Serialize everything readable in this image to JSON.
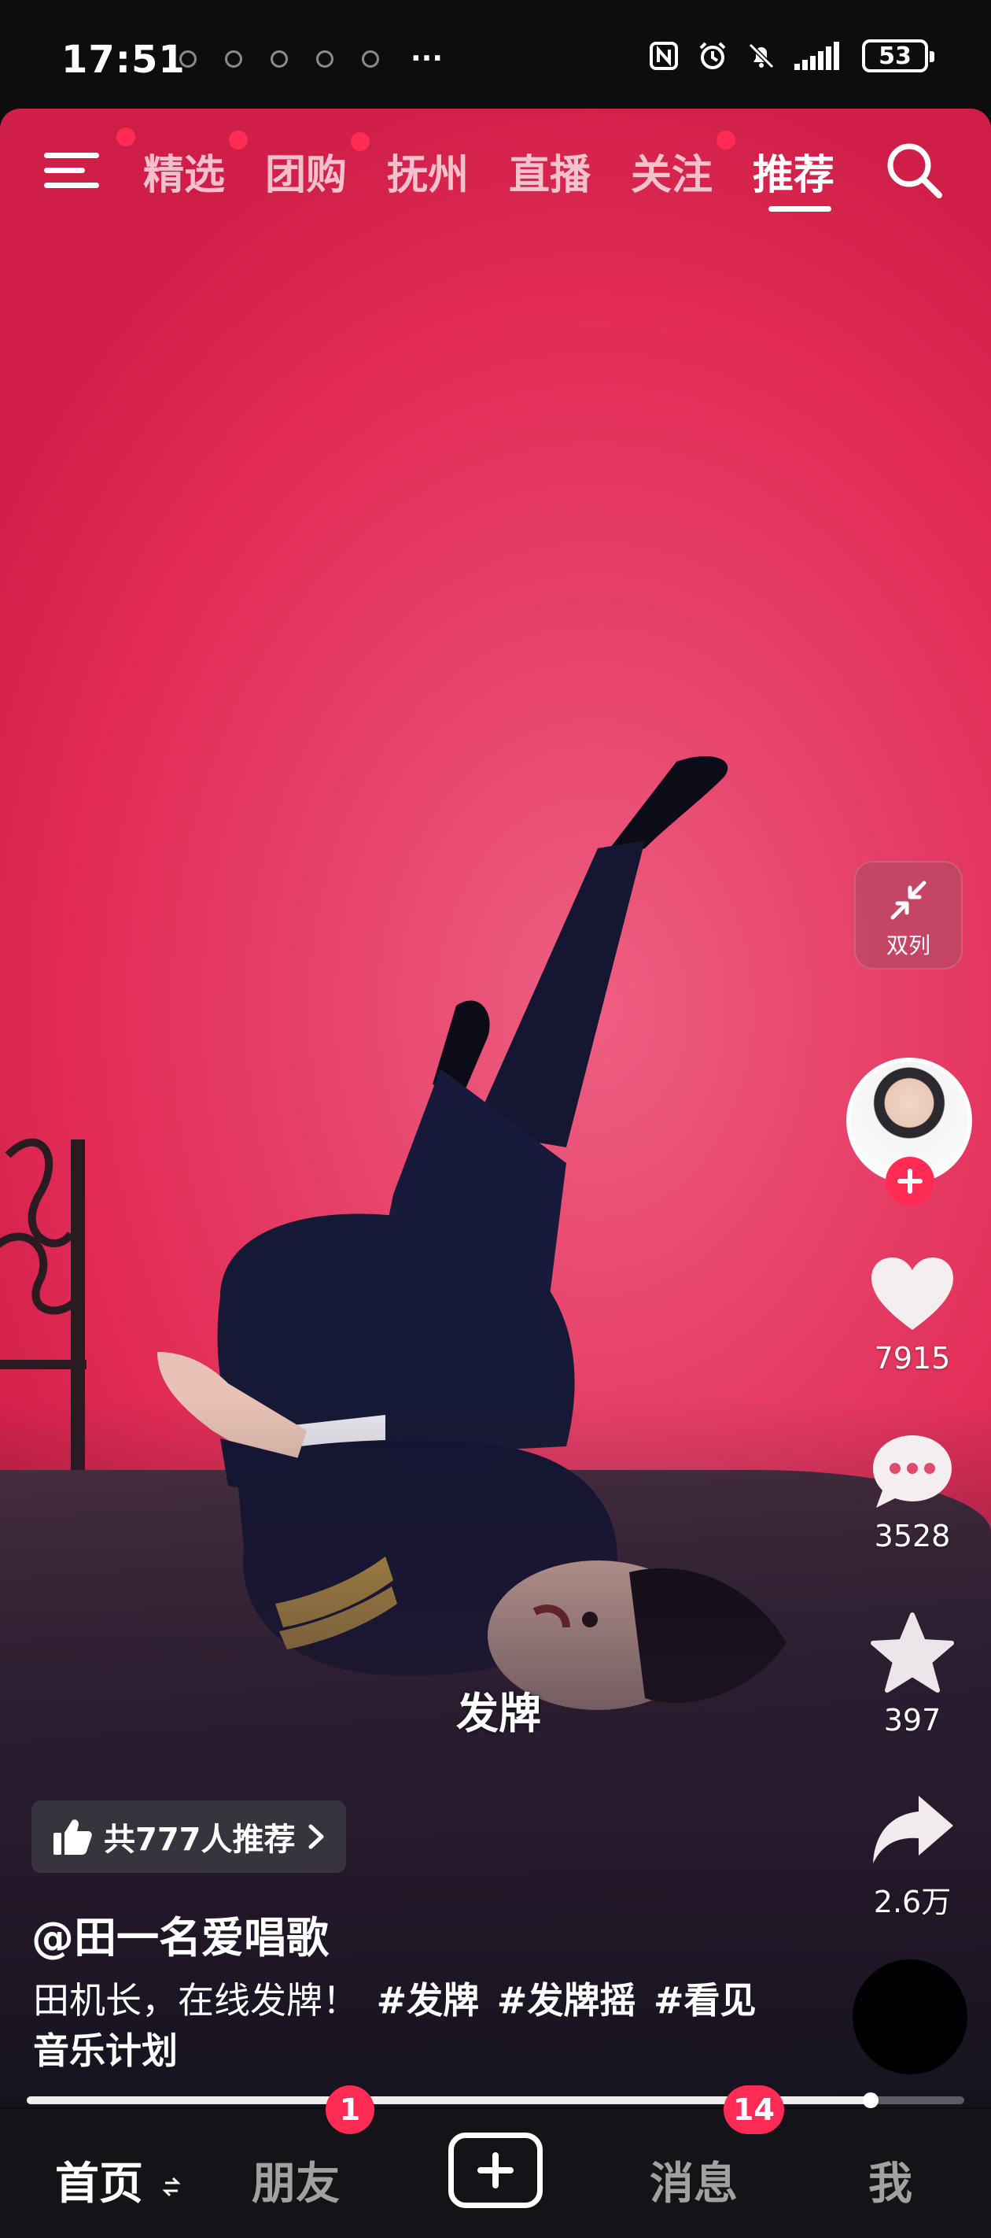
{
  "status_bar": {
    "time": "17:51",
    "more": "···",
    "battery": "53"
  },
  "top_nav": {
    "tabs": [
      {
        "label": "精选",
        "dot": true,
        "active": false
      },
      {
        "label": "团购",
        "dot": true,
        "active": false
      },
      {
        "label": "抚州",
        "dot": false,
        "active": false
      },
      {
        "label": "直播",
        "dot": false,
        "active": false
      },
      {
        "label": "关注",
        "dot": true,
        "active": false
      },
      {
        "label": "推荐",
        "dot": false,
        "active": true
      }
    ]
  },
  "video": {
    "overlay_caption": "发牌"
  },
  "actions": {
    "dual_column_label": "双列",
    "likes": "7915",
    "comments": "3528",
    "favorites": "397",
    "shares": "2.6万"
  },
  "info": {
    "recommend_text": "共777人推荐",
    "author": "@田一名爱唱歌",
    "description": "田机长，在线发牌！",
    "hashtags": [
      "#发牌",
      "#发牌摇",
      "#看见音乐计划"
    ]
  },
  "progress": {
    "played_fraction": 0.9
  },
  "bottom_nav": {
    "home": "首页",
    "friends": "朋友",
    "friends_badge": "1",
    "messages": "消息",
    "messages_badge": "14",
    "me": "我"
  },
  "colors": {
    "accent": "#ff2b55",
    "background_red": "#e63e66",
    "nav_bg": "#141418"
  }
}
